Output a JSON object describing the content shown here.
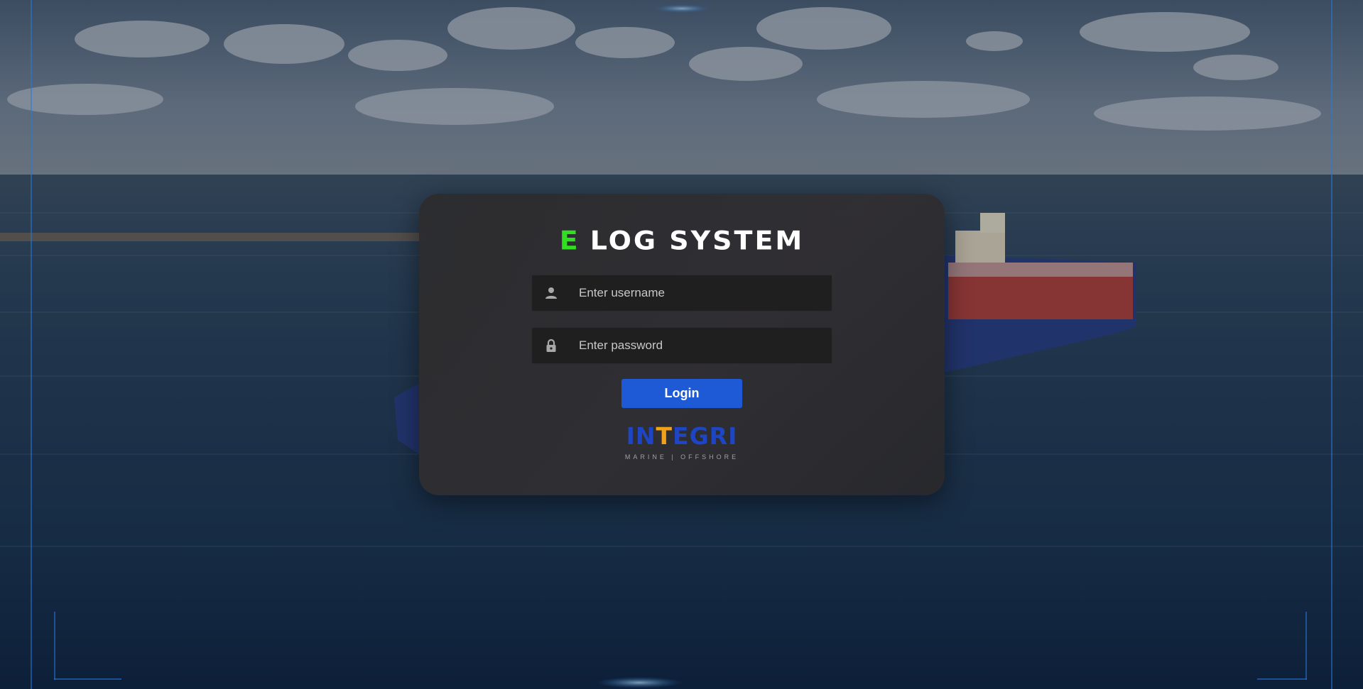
{
  "app": {
    "title_prefix": "E",
    "title_rest": "LOG SYSTEM"
  },
  "login_form": {
    "username": {
      "placeholder": "Enter username",
      "value": "",
      "icon": "user-icon"
    },
    "password": {
      "placeholder": "Enter password",
      "value": "",
      "icon": "lock-icon"
    },
    "login_label": "Login"
  },
  "brand": {
    "logo_part1": "IN",
    "logo_t": "T",
    "logo_part2": "EGRI",
    "tagline": "MARINE | OFFSHORE"
  },
  "colors": {
    "accent_green": "#2fe01f",
    "button_blue": "#1f5ad6",
    "logo_blue": "#1d45c4",
    "logo_orange": "#f2a21a",
    "card_bg": "#2c2c2e",
    "input_bg": "#1f1f20"
  }
}
